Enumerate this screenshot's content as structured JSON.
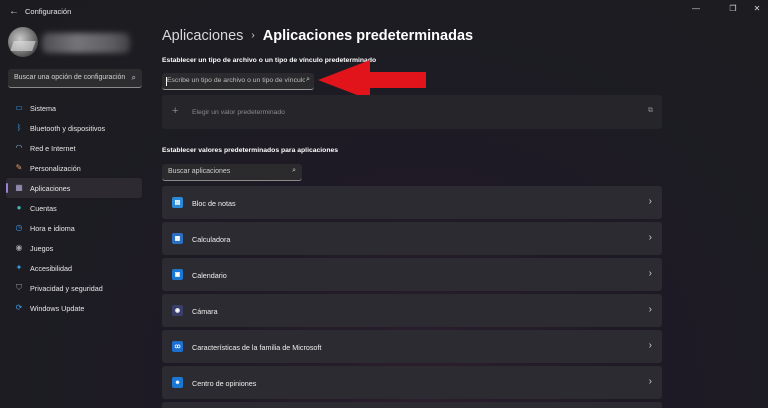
{
  "window": {
    "title": "Configuración",
    "back_glyph": "←",
    "controls": [
      "—",
      "❐",
      "✕"
    ]
  },
  "sidebar": {
    "search_placeholder": "Buscar una opción de configuración",
    "search_icon": "⌕",
    "items": [
      {
        "label": "Sistema",
        "icon": "monitor-icon",
        "glyph": "▭",
        "color": "#3b9be8"
      },
      {
        "label": "Bluetooth y dispositivos",
        "icon": "bluetooth-icon",
        "glyph": "ᛒ",
        "color": "#3b9be8"
      },
      {
        "label": "Red e Internet",
        "icon": "wifi-icon",
        "glyph": "◠",
        "color": "#8ab8e8"
      },
      {
        "label": "Personalización",
        "icon": "brush-icon",
        "glyph": "✎",
        "color": "#e8a06a"
      },
      {
        "label": "Aplicaciones",
        "icon": "apps-icon",
        "glyph": "▦",
        "color": "#b0a8d8",
        "active": true
      },
      {
        "label": "Cuentas",
        "icon": "person-icon",
        "glyph": "●",
        "color": "#3fb6a8"
      },
      {
        "label": "Hora e idioma",
        "icon": "globe-clock-icon",
        "glyph": "◷",
        "color": "#3b9be8"
      },
      {
        "label": "Juegos",
        "icon": "gamepad-icon",
        "glyph": "◉",
        "color": "#a0a0a0"
      },
      {
        "label": "Accesibilidad",
        "icon": "accessibility-icon",
        "glyph": "✦",
        "color": "#3b9be8"
      },
      {
        "label": "Privacidad y seguridad",
        "icon": "shield-icon",
        "glyph": "⛉",
        "color": "#9a9a9a"
      },
      {
        "label": "Windows Update",
        "icon": "update-icon",
        "glyph": "⟳",
        "color": "#3b9be8"
      }
    ]
  },
  "main": {
    "breadcrumb_parent": "Aplicaciones",
    "breadcrumb_sep": "›",
    "breadcrumb_current": "Aplicaciones predeterminadas",
    "filetype_label": "Establecer un tipo de archivo o un tipo de vínculo predeterminado",
    "filetype_placeholder": "Escribe un tipo de archivo o un tipo de vínculo",
    "filetype_icon": "⌕",
    "default_plus": "+",
    "default_label": "Elegir un valor predeterminado",
    "default_ext_icon": "⧉",
    "apps_label": "Establecer valores predeterminados para aplicaciones",
    "apps_search_placeholder": "Buscar aplicaciones",
    "apps_search_icon": "⌕",
    "apps": [
      {
        "name": "Bloc de notas",
        "icon": "notepad-icon",
        "glyph": "▤",
        "color": "#2a8ad8"
      },
      {
        "name": "Calculadora",
        "icon": "calculator-icon",
        "glyph": "▦",
        "color": "#2a6fc0"
      },
      {
        "name": "Calendario",
        "icon": "calendar-icon",
        "glyph": "▣",
        "color": "#1a78d4"
      },
      {
        "name": "Cámara",
        "icon": "camera-icon",
        "glyph": "◉",
        "color": "#3a3f6a"
      },
      {
        "name": "Características de la familia de Microsoft",
        "icon": "family-icon",
        "glyph": "ꝏ",
        "color": "#1a6fd0"
      },
      {
        "name": "Centro de opiniones",
        "icon": "feedback-icon",
        "glyph": "☻",
        "color": "#1a78d4"
      },
      {
        "name": "",
        "icon": "app-icon",
        "glyph": "",
        "color": "#1a78d4"
      }
    ],
    "chevron": "›"
  },
  "colors": {
    "accent": "#9a7fd9",
    "arrow": "#e0141a"
  }
}
